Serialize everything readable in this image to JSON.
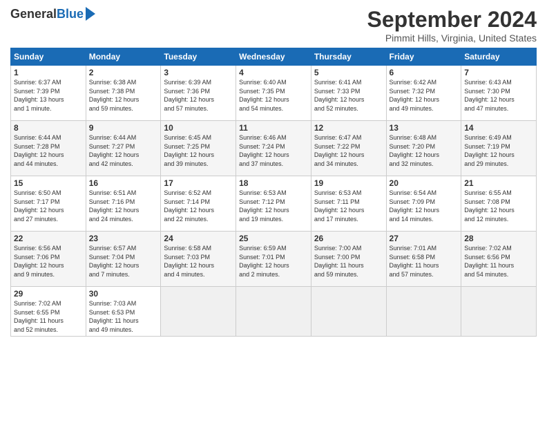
{
  "header": {
    "logo_general": "General",
    "logo_blue": "Blue",
    "title": "September 2024",
    "location": "Pimmit Hills, Virginia, United States"
  },
  "weekdays": [
    "Sunday",
    "Monday",
    "Tuesday",
    "Wednesday",
    "Thursday",
    "Friday",
    "Saturday"
  ],
  "weeks": [
    [
      {
        "day": 1,
        "info": "Sunrise: 6:37 AM\nSunset: 7:39 PM\nDaylight: 13 hours\nand 1 minute."
      },
      {
        "day": 2,
        "info": "Sunrise: 6:38 AM\nSunset: 7:38 PM\nDaylight: 12 hours\nand 59 minutes."
      },
      {
        "day": 3,
        "info": "Sunrise: 6:39 AM\nSunset: 7:36 PM\nDaylight: 12 hours\nand 57 minutes."
      },
      {
        "day": 4,
        "info": "Sunrise: 6:40 AM\nSunset: 7:35 PM\nDaylight: 12 hours\nand 54 minutes."
      },
      {
        "day": 5,
        "info": "Sunrise: 6:41 AM\nSunset: 7:33 PM\nDaylight: 12 hours\nand 52 minutes."
      },
      {
        "day": 6,
        "info": "Sunrise: 6:42 AM\nSunset: 7:32 PM\nDaylight: 12 hours\nand 49 minutes."
      },
      {
        "day": 7,
        "info": "Sunrise: 6:43 AM\nSunset: 7:30 PM\nDaylight: 12 hours\nand 47 minutes."
      }
    ],
    [
      {
        "day": 8,
        "info": "Sunrise: 6:44 AM\nSunset: 7:28 PM\nDaylight: 12 hours\nand 44 minutes."
      },
      {
        "day": 9,
        "info": "Sunrise: 6:44 AM\nSunset: 7:27 PM\nDaylight: 12 hours\nand 42 minutes."
      },
      {
        "day": 10,
        "info": "Sunrise: 6:45 AM\nSunset: 7:25 PM\nDaylight: 12 hours\nand 39 minutes."
      },
      {
        "day": 11,
        "info": "Sunrise: 6:46 AM\nSunset: 7:24 PM\nDaylight: 12 hours\nand 37 minutes."
      },
      {
        "day": 12,
        "info": "Sunrise: 6:47 AM\nSunset: 7:22 PM\nDaylight: 12 hours\nand 34 minutes."
      },
      {
        "day": 13,
        "info": "Sunrise: 6:48 AM\nSunset: 7:20 PM\nDaylight: 12 hours\nand 32 minutes."
      },
      {
        "day": 14,
        "info": "Sunrise: 6:49 AM\nSunset: 7:19 PM\nDaylight: 12 hours\nand 29 minutes."
      }
    ],
    [
      {
        "day": 15,
        "info": "Sunrise: 6:50 AM\nSunset: 7:17 PM\nDaylight: 12 hours\nand 27 minutes."
      },
      {
        "day": 16,
        "info": "Sunrise: 6:51 AM\nSunset: 7:16 PM\nDaylight: 12 hours\nand 24 minutes."
      },
      {
        "day": 17,
        "info": "Sunrise: 6:52 AM\nSunset: 7:14 PM\nDaylight: 12 hours\nand 22 minutes."
      },
      {
        "day": 18,
        "info": "Sunrise: 6:53 AM\nSunset: 7:12 PM\nDaylight: 12 hours\nand 19 minutes."
      },
      {
        "day": 19,
        "info": "Sunrise: 6:53 AM\nSunset: 7:11 PM\nDaylight: 12 hours\nand 17 minutes."
      },
      {
        "day": 20,
        "info": "Sunrise: 6:54 AM\nSunset: 7:09 PM\nDaylight: 12 hours\nand 14 minutes."
      },
      {
        "day": 21,
        "info": "Sunrise: 6:55 AM\nSunset: 7:08 PM\nDaylight: 12 hours\nand 12 minutes."
      }
    ],
    [
      {
        "day": 22,
        "info": "Sunrise: 6:56 AM\nSunset: 7:06 PM\nDaylight: 12 hours\nand 9 minutes."
      },
      {
        "day": 23,
        "info": "Sunrise: 6:57 AM\nSunset: 7:04 PM\nDaylight: 12 hours\nand 7 minutes."
      },
      {
        "day": 24,
        "info": "Sunrise: 6:58 AM\nSunset: 7:03 PM\nDaylight: 12 hours\nand 4 minutes."
      },
      {
        "day": 25,
        "info": "Sunrise: 6:59 AM\nSunset: 7:01 PM\nDaylight: 12 hours\nand 2 minutes."
      },
      {
        "day": 26,
        "info": "Sunrise: 7:00 AM\nSunset: 7:00 PM\nDaylight: 11 hours\nand 59 minutes."
      },
      {
        "day": 27,
        "info": "Sunrise: 7:01 AM\nSunset: 6:58 PM\nDaylight: 11 hours\nand 57 minutes."
      },
      {
        "day": 28,
        "info": "Sunrise: 7:02 AM\nSunset: 6:56 PM\nDaylight: 11 hours\nand 54 minutes."
      }
    ],
    [
      {
        "day": 29,
        "info": "Sunrise: 7:02 AM\nSunset: 6:55 PM\nDaylight: 11 hours\nand 52 minutes."
      },
      {
        "day": 30,
        "info": "Sunrise: 7:03 AM\nSunset: 6:53 PM\nDaylight: 11 hours\nand 49 minutes."
      },
      {
        "day": null,
        "info": ""
      },
      {
        "day": null,
        "info": ""
      },
      {
        "day": null,
        "info": ""
      },
      {
        "day": null,
        "info": ""
      },
      {
        "day": null,
        "info": ""
      }
    ]
  ]
}
